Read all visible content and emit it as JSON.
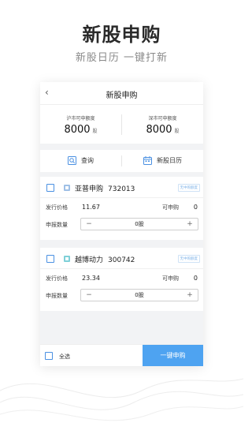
{
  "promo": {
    "title": "新股申购",
    "subtitle": "新股日历 一键打新"
  },
  "app": {
    "nav_title": "新股申购",
    "back_icon": "‹",
    "quota": {
      "sh_label": "沪市可申额度",
      "sh_value": "8000",
      "sh_unit": "股",
      "sz_label": "深市可申额度",
      "sz_value": "8000",
      "sz_unit": "股"
    },
    "actions": {
      "query": "查询",
      "calendar": "新股日历"
    },
    "stocks": [
      {
        "name": "亚普申购",
        "code": "732013",
        "tag": "无中购额度",
        "issue_label": "发行价格",
        "issue_price": "11.67",
        "can_label": "可申购",
        "can_value": "0",
        "qty_label": "申报数量",
        "qty_value": "0股",
        "minus": "−",
        "plus": "+"
      },
      {
        "name": "越博动力",
        "code": "300742",
        "tag": "无中购额度",
        "issue_label": "发行价格",
        "issue_price": "23.34",
        "can_label": "可申购",
        "can_value": "0",
        "qty_label": "申报数量",
        "qty_value": "0股",
        "minus": "−",
        "plus": "+"
      }
    ],
    "bottom": {
      "select_all": "全选",
      "buy": "一键申购"
    }
  },
  "colors": {
    "accent": "#4ea3f1",
    "checkbox": "#4a90e2",
    "tag": "#7fb3e8"
  }
}
